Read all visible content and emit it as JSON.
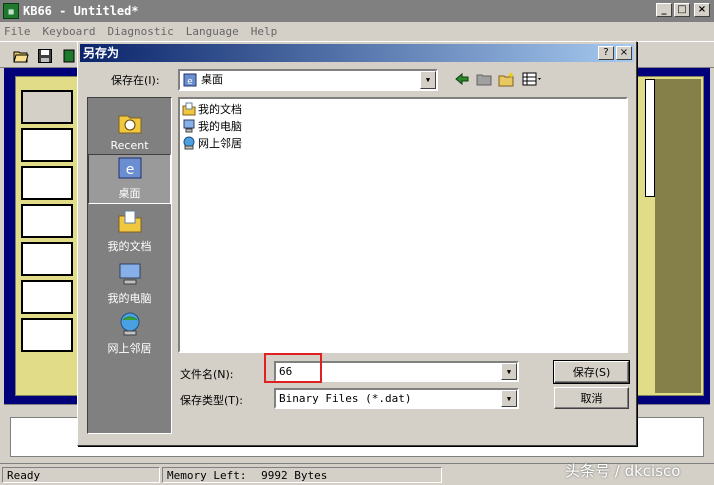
{
  "app": {
    "title": "KB66 - Untitled*",
    "icon": "app-icon",
    "window_controls": [
      "minimize",
      "maximize",
      "close"
    ]
  },
  "menu": [
    "File",
    "Keyboard",
    "Diagnostic",
    "Language",
    "Help"
  ],
  "toolbar": {
    "buttons": [
      "open-folder-icon",
      "save-disk-icon",
      "tool-icon"
    ]
  },
  "status": {
    "ready": "Ready",
    "memory_label": "Memory Left:",
    "memory_value": "9992 Bytes"
  },
  "dialog": {
    "title": "另存为",
    "save_in_label": "保存在(I):",
    "save_in_value": "桌面",
    "toolbar_icons": [
      "back-arrow-icon",
      "up-folder-icon",
      "new-folder-icon",
      "view-menu-icon"
    ],
    "places": [
      {
        "label": "Recent",
        "icon": "recent-folder-icon"
      },
      {
        "label": "桌面",
        "icon": "desktop-icon"
      },
      {
        "label": "我的文档",
        "icon": "my-documents-icon"
      },
      {
        "label": "我的电脑",
        "icon": "my-computer-icon"
      },
      {
        "label": "网上邻居",
        "icon": "network-places-icon"
      }
    ],
    "files": [
      {
        "label": "我的文档",
        "icon": "documents-icon"
      },
      {
        "label": "我的电脑",
        "icon": "computer-icon"
      },
      {
        "label": "网上邻居",
        "icon": "network-icon"
      }
    ],
    "filename_label": "文件名(N):",
    "filename_value": "66",
    "filetype_label": "保存类型(T):",
    "filetype_value": "Binary Files (*.dat)",
    "save_button": "保存(S)",
    "cancel_button": "取消",
    "help_button": "?",
    "close_button": "×"
  },
  "watermark": "头条号 / dkcisco",
  "colors": {
    "workspace_blue": "#00007a",
    "panel_yellow": "#e0dc88",
    "title_gradient_start": "#0a246a",
    "highlight_red": "#e02020"
  }
}
